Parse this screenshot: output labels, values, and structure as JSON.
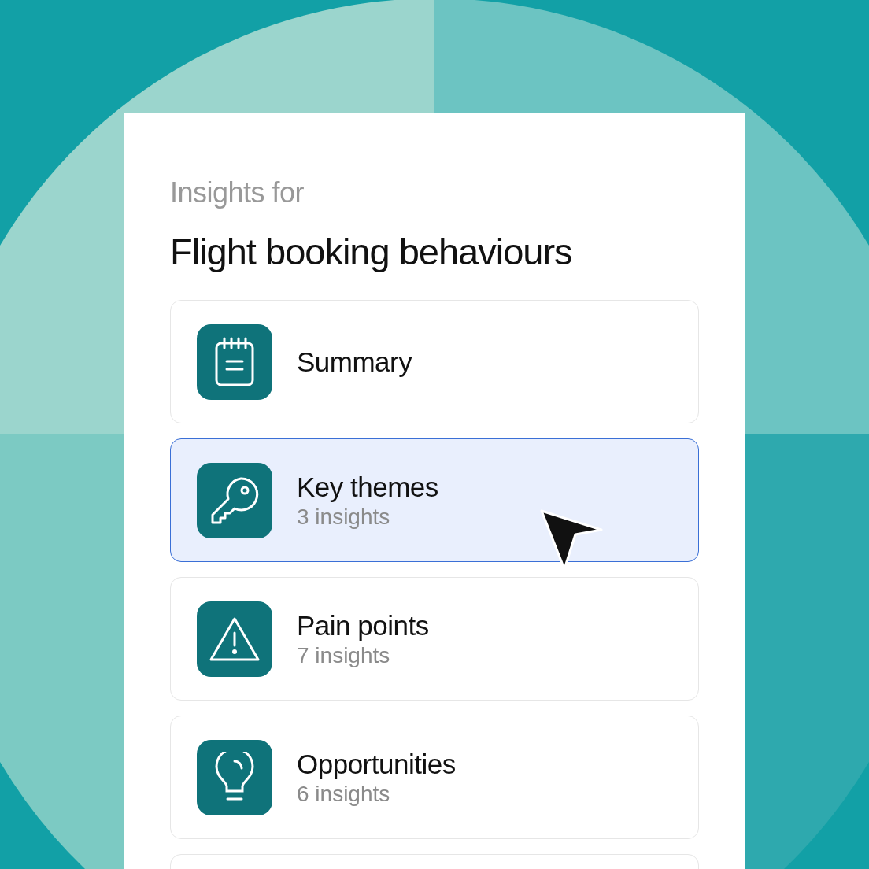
{
  "header": {
    "eyebrow": "Insights for",
    "title": "Flight booking behaviours"
  },
  "items": [
    {
      "label": "Summary",
      "selected": false
    },
    {
      "label": "Key themes",
      "count": "3 insights",
      "selected": true
    },
    {
      "label": "Pain points",
      "count": "7 insights",
      "selected": false
    },
    {
      "label": "Opportunities",
      "count": "6 insights",
      "selected": false
    }
  ]
}
